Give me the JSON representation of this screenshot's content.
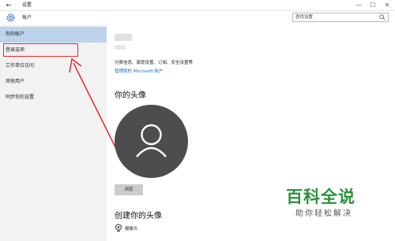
{
  "window": {
    "title": "设置",
    "minimize_glyph": "—",
    "maximize_glyph": "☐",
    "close_glyph": "✕",
    "back_glyph": "←"
  },
  "header": {
    "section_title": "帐户",
    "search_placeholder": "查找设置"
  },
  "sidebar": {
    "items": [
      {
        "label": "你的帐户",
        "selected": true
      },
      {
        "label": "登录选项",
        "selected": false
      },
      {
        "label": "工作单位访问",
        "selected": false
      },
      {
        "label": "其他用户",
        "selected": false
      },
      {
        "label": "同步你的设置",
        "selected": false
      }
    ]
  },
  "main": {
    "info_text": "付费信息、家庭设置、订阅、安全设置等",
    "manage_link": "管理我的 Microsoft 帐户",
    "avatar_heading": "你的头像",
    "browse_button": "浏览",
    "create_heading": "创建你的头像",
    "camera_label": "摄像头"
  },
  "watermark": {
    "title": "百科全说",
    "subtitle": "助你轻松解决"
  },
  "colors": {
    "selected_nav": "#bdd3ec",
    "link": "#1b6ac9",
    "annotation_red": "#e8282f",
    "watermark_green": "#2b9240",
    "avatar_bg": "#4d4d4d"
  }
}
